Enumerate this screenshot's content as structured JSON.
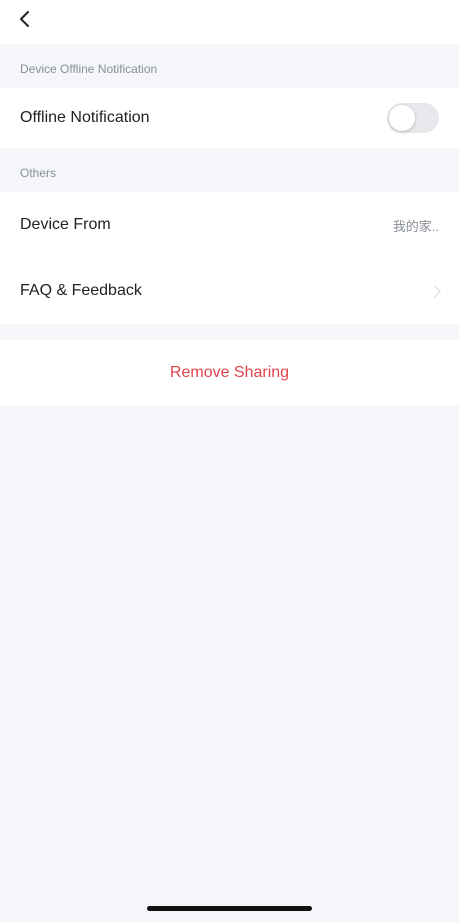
{
  "header": {
    "back_icon": "chevron-left-icon"
  },
  "sections": {
    "offline": {
      "title": "Device Offline Notification",
      "row_label": "Offline Notification",
      "toggle_on": false
    },
    "others": {
      "title": "Others",
      "device_from_label": "Device From",
      "device_from_value": "我的家..",
      "faq_label": "FAQ & Feedback"
    }
  },
  "actions": {
    "remove_label": "Remove Sharing",
    "remove_color": "#e0434a"
  }
}
